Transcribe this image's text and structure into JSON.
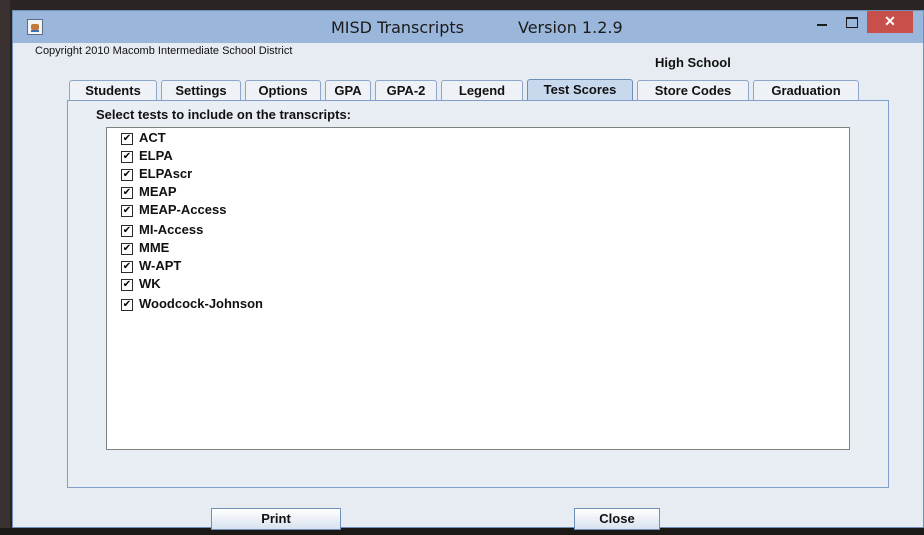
{
  "window": {
    "title": "MISD Transcripts",
    "version": "Version 1.2.9",
    "minimize": "—",
    "maximize": "□",
    "close": "✕"
  },
  "header": {
    "copyright": "Copyright 2010 Macomb Intermediate School District",
    "school": "High School"
  },
  "tabs": [
    {
      "label": "Students"
    },
    {
      "label": "Settings"
    },
    {
      "label": "Options"
    },
    {
      "label": "GPA"
    },
    {
      "label": "GPA-2"
    },
    {
      "label": "Legend"
    },
    {
      "label": "Test Scores",
      "active": true
    },
    {
      "label": "Store Codes"
    },
    {
      "label": "Graduation"
    }
  ],
  "test_scores": {
    "prompt": "Select tests to include on the transcripts:",
    "items": [
      {
        "label": "ACT",
        "checked": true
      },
      {
        "label": "ELPA",
        "checked": true
      },
      {
        "label": "ELPAscr",
        "checked": true
      },
      {
        "label": "MEAP",
        "checked": true
      },
      {
        "label": "MEAP-Access",
        "checked": true
      },
      {
        "label": "MI-Access",
        "checked": true
      },
      {
        "label": "MME",
        "checked": true
      },
      {
        "label": "W-APT",
        "checked": true
      },
      {
        "label": "WK",
        "checked": true
      },
      {
        "label": "Woodcock-Johnson",
        "checked": true
      }
    ],
    "check_mark": "✔"
  },
  "buttons": {
    "print": "Print",
    "close": "Close"
  },
  "colors": {
    "titlebar": "#9ab6da",
    "close_button": "#c7504a",
    "active_tab": "#c8d9ee"
  }
}
